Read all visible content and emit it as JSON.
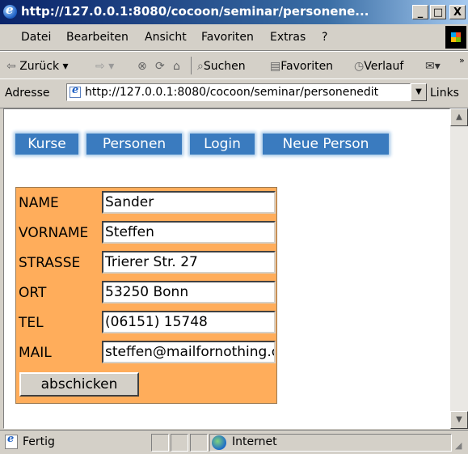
{
  "window": {
    "title": "http://127.0.0.1:8080/cocoon/seminar/personene...",
    "minimize": "_",
    "maximize": "□",
    "close": "X"
  },
  "menu": [
    {
      "label": "Datei"
    },
    {
      "label": "Bearbeiten"
    },
    {
      "label": "Ansicht"
    },
    {
      "label": "Favoriten"
    },
    {
      "label": "Extras"
    },
    {
      "label": "?"
    }
  ],
  "toolbar": {
    "back": "Zurück",
    "search": "Suchen",
    "favorites": "Favoriten",
    "history": "Verlauf"
  },
  "address": {
    "label": "Adresse",
    "url": "http://127.0.0.1:8080/cocoon/seminar/personenedit",
    "links": "Links"
  },
  "nav": [
    {
      "label": "Kurse"
    },
    {
      "label": "Personen"
    },
    {
      "label": "Login"
    },
    {
      "label": "Neue Person"
    }
  ],
  "form": {
    "fields": [
      {
        "label": "NAME",
        "value": "Sander"
      },
      {
        "label": "VORNAME",
        "value": "Steffen"
      },
      {
        "label": "STRASSE",
        "value": "Trierer Str. 27"
      },
      {
        "label": "ORT",
        "value": "53250 Bonn"
      },
      {
        "label": "TEL",
        "value": "(06151) 15748"
      },
      {
        "label": "MAIL",
        "value": "steffen@mailfornothing.c"
      }
    ],
    "submit": "abschicken",
    "bg_color": "#ffad5b"
  },
  "status": {
    "text": "Fertig",
    "zone": "Internet"
  }
}
